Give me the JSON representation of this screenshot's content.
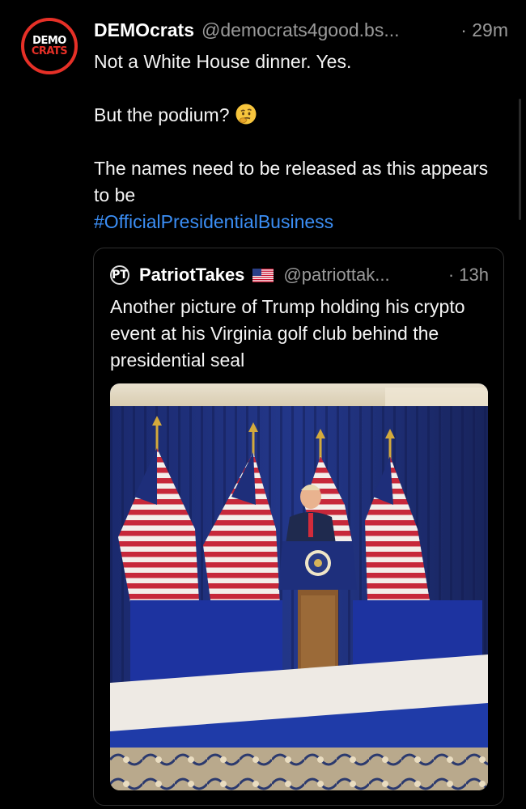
{
  "post": {
    "author_name": "DEMOcrats",
    "author_handle": "@democrats4good.bs...",
    "time": "· 29m",
    "avatar": {
      "line1": "DEMO",
      "line2": "CRATS",
      "ring_color": "#e63027"
    },
    "paragraph1": "Not a White House dinner. Yes.",
    "paragraph2": "But the podium?",
    "paragraph2_emoji": "thinking-face-icon",
    "paragraph3": "The names need to be released as this appears to be",
    "hashtag": "#OfficialPresidentialBusiness",
    "hashtag_color": "#3b8ef5"
  },
  "quote": {
    "logo": "PT",
    "author_name": "PatriotTakes",
    "author_flag": "us-flag-icon",
    "author_handle": "@patriottak...",
    "time": "· 13h",
    "text": "Another picture of Trump holding his crypto event at his Virginia golf club behind the presidential seal"
  }
}
